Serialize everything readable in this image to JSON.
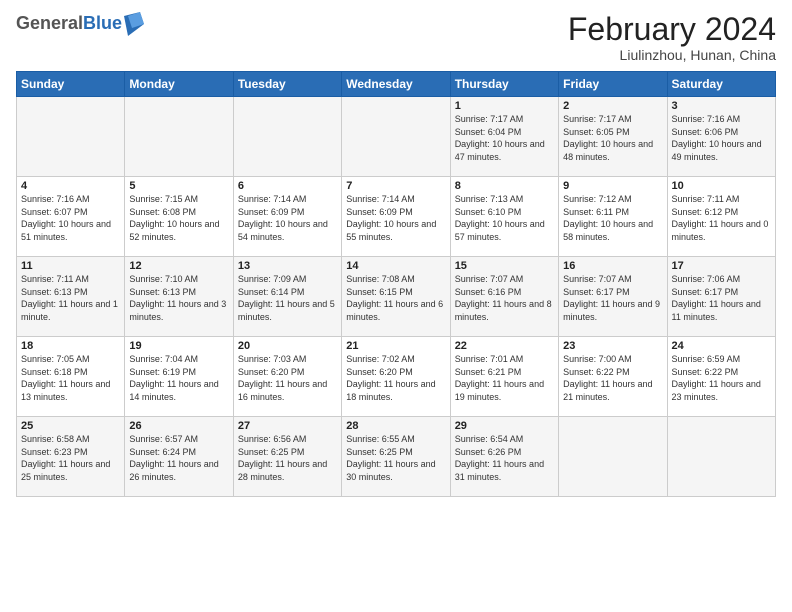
{
  "logo": {
    "general": "General",
    "blue": "Blue"
  },
  "title": "February 2024",
  "subtitle": "Liulinzhou, Hunan, China",
  "weekdays": [
    "Sunday",
    "Monday",
    "Tuesday",
    "Wednesday",
    "Thursday",
    "Friday",
    "Saturday"
  ],
  "weeks": [
    [
      {
        "day": "",
        "info": ""
      },
      {
        "day": "",
        "info": ""
      },
      {
        "day": "",
        "info": ""
      },
      {
        "day": "",
        "info": ""
      },
      {
        "day": "1",
        "info": "Sunrise: 7:17 AM\nSunset: 6:04 PM\nDaylight: 10 hours\nand 47 minutes."
      },
      {
        "day": "2",
        "info": "Sunrise: 7:17 AM\nSunset: 6:05 PM\nDaylight: 10 hours\nand 48 minutes."
      },
      {
        "day": "3",
        "info": "Sunrise: 7:16 AM\nSunset: 6:06 PM\nDaylight: 10 hours\nand 49 minutes."
      }
    ],
    [
      {
        "day": "4",
        "info": "Sunrise: 7:16 AM\nSunset: 6:07 PM\nDaylight: 10 hours\nand 51 minutes."
      },
      {
        "day": "5",
        "info": "Sunrise: 7:15 AM\nSunset: 6:08 PM\nDaylight: 10 hours\nand 52 minutes."
      },
      {
        "day": "6",
        "info": "Sunrise: 7:14 AM\nSunset: 6:09 PM\nDaylight: 10 hours\nand 54 minutes."
      },
      {
        "day": "7",
        "info": "Sunrise: 7:14 AM\nSunset: 6:09 PM\nDaylight: 10 hours\nand 55 minutes."
      },
      {
        "day": "8",
        "info": "Sunrise: 7:13 AM\nSunset: 6:10 PM\nDaylight: 10 hours\nand 57 minutes."
      },
      {
        "day": "9",
        "info": "Sunrise: 7:12 AM\nSunset: 6:11 PM\nDaylight: 10 hours\nand 58 minutes."
      },
      {
        "day": "10",
        "info": "Sunrise: 7:11 AM\nSunset: 6:12 PM\nDaylight: 11 hours\nand 0 minutes."
      }
    ],
    [
      {
        "day": "11",
        "info": "Sunrise: 7:11 AM\nSunset: 6:13 PM\nDaylight: 11 hours\nand 1 minute."
      },
      {
        "day": "12",
        "info": "Sunrise: 7:10 AM\nSunset: 6:13 PM\nDaylight: 11 hours\nand 3 minutes."
      },
      {
        "day": "13",
        "info": "Sunrise: 7:09 AM\nSunset: 6:14 PM\nDaylight: 11 hours\nand 5 minutes."
      },
      {
        "day": "14",
        "info": "Sunrise: 7:08 AM\nSunset: 6:15 PM\nDaylight: 11 hours\nand 6 minutes."
      },
      {
        "day": "15",
        "info": "Sunrise: 7:07 AM\nSunset: 6:16 PM\nDaylight: 11 hours\nand 8 minutes."
      },
      {
        "day": "16",
        "info": "Sunrise: 7:07 AM\nSunset: 6:17 PM\nDaylight: 11 hours\nand 9 minutes."
      },
      {
        "day": "17",
        "info": "Sunrise: 7:06 AM\nSunset: 6:17 PM\nDaylight: 11 hours\nand 11 minutes."
      }
    ],
    [
      {
        "day": "18",
        "info": "Sunrise: 7:05 AM\nSunset: 6:18 PM\nDaylight: 11 hours\nand 13 minutes."
      },
      {
        "day": "19",
        "info": "Sunrise: 7:04 AM\nSunset: 6:19 PM\nDaylight: 11 hours\nand 14 minutes."
      },
      {
        "day": "20",
        "info": "Sunrise: 7:03 AM\nSunset: 6:20 PM\nDaylight: 11 hours\nand 16 minutes."
      },
      {
        "day": "21",
        "info": "Sunrise: 7:02 AM\nSunset: 6:20 PM\nDaylight: 11 hours\nand 18 minutes."
      },
      {
        "day": "22",
        "info": "Sunrise: 7:01 AM\nSunset: 6:21 PM\nDaylight: 11 hours\nand 19 minutes."
      },
      {
        "day": "23",
        "info": "Sunrise: 7:00 AM\nSunset: 6:22 PM\nDaylight: 11 hours\nand 21 minutes."
      },
      {
        "day": "24",
        "info": "Sunrise: 6:59 AM\nSunset: 6:22 PM\nDaylight: 11 hours\nand 23 minutes."
      }
    ],
    [
      {
        "day": "25",
        "info": "Sunrise: 6:58 AM\nSunset: 6:23 PM\nDaylight: 11 hours\nand 25 minutes."
      },
      {
        "day": "26",
        "info": "Sunrise: 6:57 AM\nSunset: 6:24 PM\nDaylight: 11 hours\nand 26 minutes."
      },
      {
        "day": "27",
        "info": "Sunrise: 6:56 AM\nSunset: 6:25 PM\nDaylight: 11 hours\nand 28 minutes."
      },
      {
        "day": "28",
        "info": "Sunrise: 6:55 AM\nSunset: 6:25 PM\nDaylight: 11 hours\nand 30 minutes."
      },
      {
        "day": "29",
        "info": "Sunrise: 6:54 AM\nSunset: 6:26 PM\nDaylight: 11 hours\nand 31 minutes."
      },
      {
        "day": "",
        "info": ""
      },
      {
        "day": "",
        "info": ""
      }
    ]
  ]
}
